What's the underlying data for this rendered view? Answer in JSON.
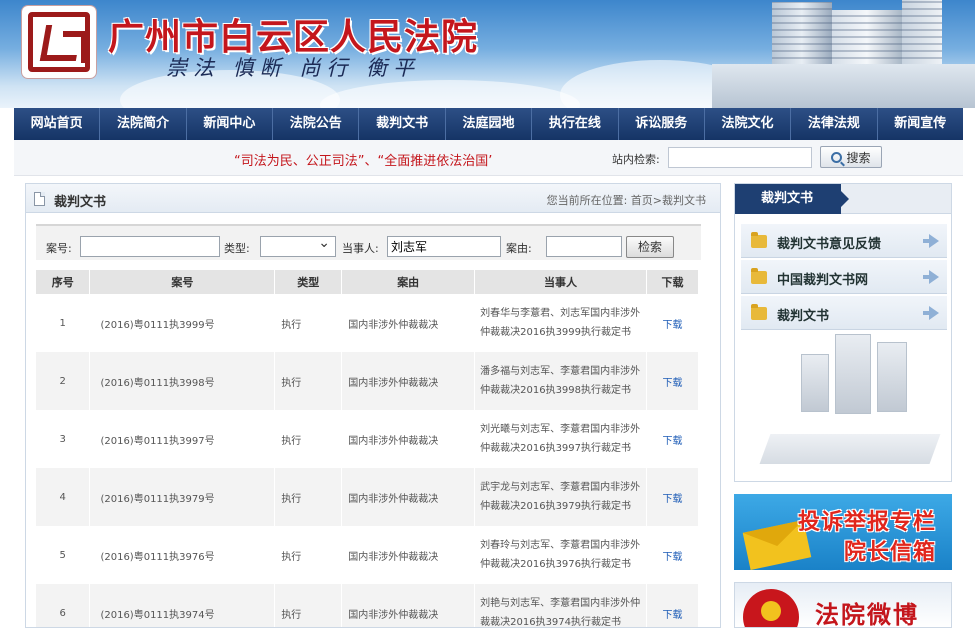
{
  "header": {
    "site_title": "广州市白云区人民法院",
    "motto": "崇法 慎断 尚行 衡平"
  },
  "nav": {
    "items": [
      "网站首页",
      "法院简介",
      "新闻中心",
      "法院公告",
      "裁判文书",
      "法庭园地",
      "执行在线",
      "诉讼服务",
      "法院文化",
      "法律法规",
      "新闻宣传"
    ]
  },
  "notice_bar": {
    "slogan": "“司法为民、公正司法”、“全面推进依法治国’",
    "search_label": "站内检索:",
    "search_value": "",
    "search_button": "搜索"
  },
  "main": {
    "title": "裁判文书",
    "breadcrumb": "您当前所在位置: 首页>裁判文书",
    "filter": {
      "case_no_label": "案号:",
      "case_no_value": "",
      "type_label": "类型:",
      "type_value": "",
      "party_label": "当事人:",
      "party_value": "刘志军",
      "reason_label": "案由:",
      "reason_value": "",
      "search_button": "检索"
    },
    "table": {
      "headers": [
        "序号",
        "案号",
        "类型",
        "案由",
        "当事人",
        "下载"
      ],
      "rows": [
        {
          "no": "1",
          "case": "(2016)粤0111执3999号",
          "type": "执行",
          "reason": "国内非涉外仲裁裁决",
          "party": "刘春华与李薏君、刘志军国内非涉外仲裁裁决2016执3999执行裁定书",
          "download": "下载"
        },
        {
          "no": "2",
          "case": "(2016)粤0111执3998号",
          "type": "执行",
          "reason": "国内非涉外仲裁裁决",
          "party": "潘多福与刘志军、李薏君国内非涉外仲裁裁决2016执3998执行裁定书",
          "download": "下载"
        },
        {
          "no": "3",
          "case": "(2016)粤0111执3997号",
          "type": "执行",
          "reason": "国内非涉外仲裁裁决",
          "party": "刘光曦与刘志军、李薏君国内非涉外仲裁裁决2016执3997执行裁定书",
          "download": "下载"
        },
        {
          "no": "4",
          "case": "(2016)粤0111执3979号",
          "type": "执行",
          "reason": "国内非涉外仲裁裁决",
          "party": "武宇龙与刘志军、李薏君国内非涉外仲裁裁决2016执3979执行裁定书",
          "download": "下载"
        },
        {
          "no": "5",
          "case": "(2016)粤0111执3976号",
          "type": "执行",
          "reason": "国内非涉外仲裁裁决",
          "party": "刘春玲与刘志军、李薏君国内非涉外仲裁裁决2016执3976执行裁定书",
          "download": "下载"
        },
        {
          "no": "6",
          "case": "(2016)粤0111执3974号",
          "type": "执行",
          "reason": "国内非涉外仲裁裁决",
          "party": "刘艳与刘志军、李薏君国内非涉外仲裁裁决2016执3974执行裁定书",
          "download": "下载"
        }
      ]
    }
  },
  "sidebar": {
    "title": "裁判文书",
    "items": [
      "裁判文书意见反馈",
      "中国裁判文书网",
      "裁判文书"
    ]
  },
  "banners": {
    "complaint_line1": "投诉举报专栏",
    "complaint_line2": "院长信箱",
    "weibo": "法院微博"
  },
  "colors": {
    "nav_bg": "#1e3f72",
    "title_red": "#c4161c",
    "link_blue": "#1c5bb6"
  }
}
